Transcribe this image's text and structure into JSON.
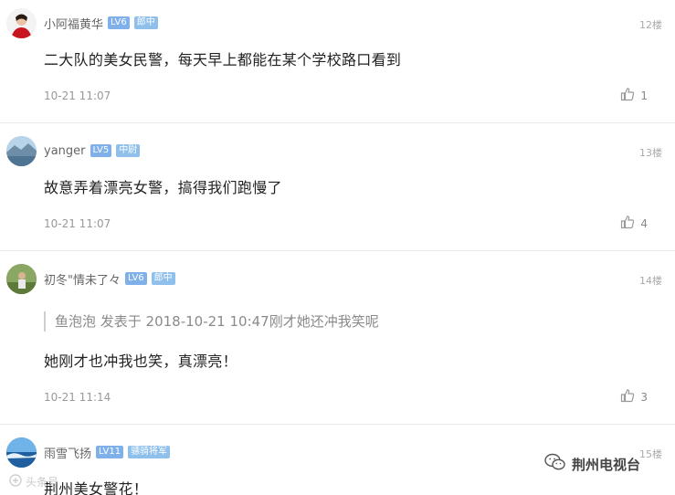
{
  "comments": [
    {
      "username": "小阿福黄华",
      "level": "LV6",
      "title": "郎中",
      "floor": "12楼",
      "content": "二大队的美女民警，每天早上都能在某个学校路口看到",
      "time": "10-21 11:07",
      "likes": "1"
    },
    {
      "username": "yanger",
      "level": "LV5",
      "title": "中尉",
      "floor": "13楼",
      "content": "故意弄着漂亮女警，搞得我们跑慢了",
      "time": "10-21 11:07",
      "likes": "4"
    },
    {
      "username": "初冬\"情未了々",
      "level": "LV6",
      "title": "郎中",
      "floor": "14楼",
      "quote": "鱼泡泡 发表于 2018-10-21 10:47刚才她还冲我笑呢",
      "content": "她刚才也冲我也笑，真漂亮！",
      "time": "10-21 11:14",
      "likes": "3"
    },
    {
      "username": "雨雪飞扬",
      "level": "LV11",
      "title": "骠骑将军",
      "floor": "15楼",
      "content": "荆州美女警花！"
    }
  ],
  "watermarks": {
    "left": "头条号",
    "right": "荆州电视台"
  },
  "icons": {
    "like": "thumbs-up-icon",
    "wechat": "wechat-icon"
  }
}
